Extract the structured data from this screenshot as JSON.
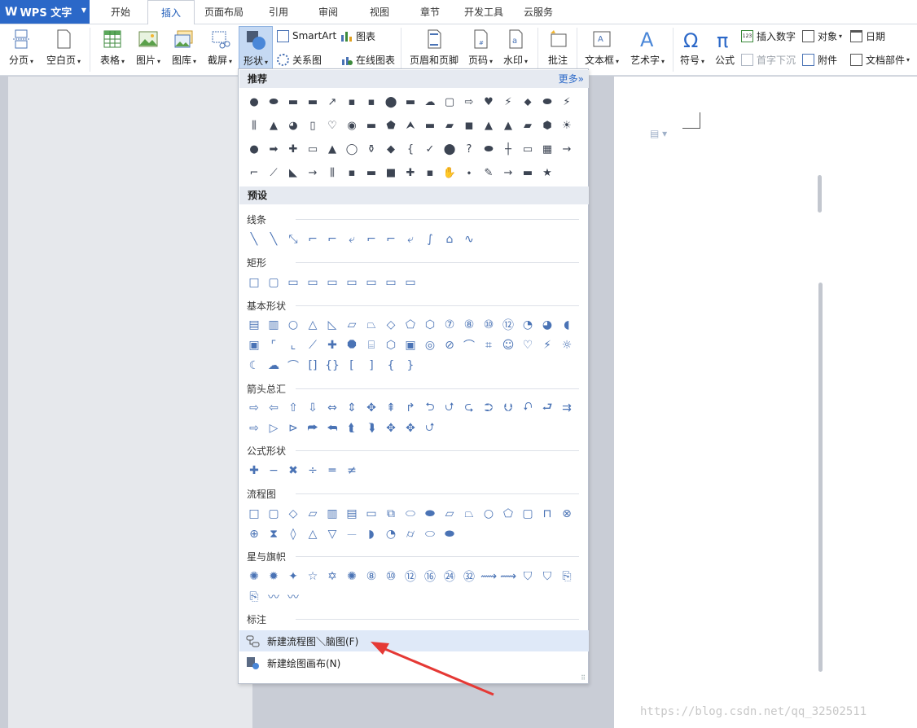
{
  "app": {
    "title": "WPS 文字"
  },
  "tabs": [
    "开始",
    "插入",
    "页面布局",
    "引用",
    "审阅",
    "视图",
    "章节",
    "开发工具",
    "云服务"
  ],
  "ribbon": {
    "page_break": "分页",
    "blank_page": "空白页",
    "table": "表格",
    "picture": "图片",
    "gallery": "图库",
    "screenshot": "截屏",
    "shapes": "形状",
    "smartart": "SmartArt",
    "chart": "图表",
    "relation": "关系图",
    "online_chart": "在线图表",
    "header_footer": "页眉和页脚",
    "page_number": "页码",
    "watermark": "水印",
    "comment": "批注",
    "textbox": "文本框",
    "wordart": "艺术字",
    "symbol": "符号",
    "formula": "公式",
    "insert_number": "插入数字",
    "drop_cap": "首字下沉",
    "object": "对象",
    "attachment": "附件",
    "date": "日期",
    "doc_parts": "文档部件"
  },
  "menu": {
    "recommended": "推荐",
    "more": "更多»",
    "preset": "预设",
    "rec_icons": [
      "●",
      "⬬",
      "▬",
      "▬",
      "↗",
      "▪",
      "▪",
      "⬤",
      "▬",
      "☁",
      "▢",
      "⇨",
      "♥",
      "⚡",
      "⬥",
      "⬬",
      "⚡",
      "⫼",
      "▲",
      "◕",
      "▯",
      "♡",
      "◉",
      "▬",
      "⬟",
      "⮝",
      "▬",
      "▰",
      "◼",
      "▲",
      "▲",
      "▰",
      "⬢",
      "☀",
      "●",
      "➡",
      "✚",
      "▭",
      "▲",
      "◯",
      "⚱",
      "◆",
      "{",
      "✓",
      "⬤",
      "?",
      "⬬",
      "┼",
      "▭",
      "▦",
      "→",
      "⌐",
      "⟋",
      "◣",
      "→",
      "⫼",
      "▪",
      "▬",
      "■",
      "✚",
      "▪",
      "✋",
      "⬩",
      "✎",
      "→",
      "▬",
      "★"
    ],
    "categories": {
      "lines": "线条",
      "rect": "矩形",
      "basic": "基本形状",
      "arrows": "箭头总汇",
      "equation": "公式形状",
      "flowchart": "流程图",
      "stars": "星与旗帜",
      "callouts": "标注"
    },
    "line_icons": [
      "╲",
      "╲",
      "⤡",
      "⌐",
      "⌐",
      "⤶",
      "⌐",
      "⌐",
      "⤶",
      "∫",
      "⌂",
      "∿"
    ],
    "rect_icons": [
      "□",
      "▢",
      "▭",
      "▭",
      "▭",
      "▭",
      "▭",
      "▭",
      "▭"
    ],
    "basic_icons": [
      "▤",
      "▥",
      "○",
      "△",
      "◺",
      "▱",
      "⏢",
      "◇",
      "⬠",
      "⬡",
      "⑦",
      "⑧",
      "⑩",
      "⑫",
      "◔",
      "◕",
      "◖",
      "▣",
      "⌜",
      "⌞",
      "⟋",
      "✚",
      "⯃",
      "⌸",
      "⬡",
      "▣",
      "◎",
      "⊘",
      "⌒",
      "⌗",
      "☺",
      "♡",
      "⚡",
      "☼",
      "☾",
      "☁",
      "⌒",
      "[]",
      "{}",
      "[",
      "]",
      "{",
      "}"
    ],
    "arrow_icons": [
      "⇨",
      "⇦",
      "⇧",
      "⇩",
      "⇔",
      "⇕",
      "✥",
      "⇞",
      "↱",
      "⮌",
      "⮍",
      "⮎",
      "⮊",
      "⮋",
      "⮏",
      "⮐",
      "⇉",
      "⇨",
      "▷",
      "⊳",
      "⮫",
      "⮪",
      "⮬",
      "⮯",
      "✥",
      "✥",
      "⮍"
    ],
    "eq_icons": [
      "✚",
      "−",
      "✖",
      "÷",
      "═",
      "≠"
    ],
    "flow_icons": [
      "□",
      "▢",
      "◇",
      "▱",
      "▥",
      "▤",
      "▭",
      "⧉",
      "⬭",
      "⬬",
      "⏥",
      "⏢",
      "○",
      "⬠",
      "▢",
      "⊓",
      "⊗",
      "⊕",
      "⧗",
      "◊",
      "△",
      "▽",
      "⏤",
      "◗",
      "◔",
      "⌭",
      "⬭",
      "⬬"
    ],
    "star_icons": [
      "✺",
      "✹",
      "✦",
      "☆",
      "✡",
      "✺",
      "⑧",
      "⑩",
      "⑫",
      "⑯",
      "㉔",
      "㉜",
      "⟿",
      "⟿",
      "⛉",
      "⛉",
      "⎘",
      "⎘",
      "〰",
      "〰"
    ],
    "new_flowchart": "新建流程图＼脑图(F)",
    "new_canvas": "新建绘图画布(N)"
  },
  "watermark": "https://blog.csdn.net/qq_32502511",
  "colors": {
    "accent": "#2b68c8",
    "arrow": "#e53935"
  }
}
